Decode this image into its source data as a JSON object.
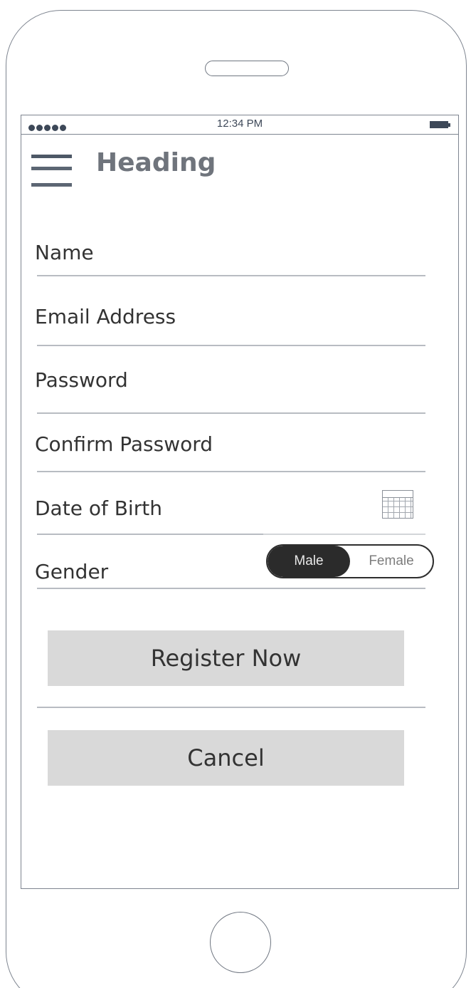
{
  "status_bar": {
    "time": "12:34 PM",
    "signal_dots": 5,
    "battery_icon": "battery-icon"
  },
  "header": {
    "menu_icon": "hamburger-menu-icon",
    "title": "Heading"
  },
  "form": {
    "name_label": "Name",
    "email_label": "Email Address",
    "password_label": "Password",
    "confirm_password_label": "Confirm Password",
    "dob_label": "Date of Birth",
    "dob_icon": "calendar-icon",
    "gender_label": "Gender",
    "gender_options": [
      "Male",
      "Female"
    ],
    "gender_selected": "Male"
  },
  "actions": {
    "register_label": "Register Now",
    "cancel_label": "Cancel"
  },
  "colors": {
    "button_bg": "#d9d9d9",
    "toggle_active": "#2b2b2b",
    "heading": "#6f747c",
    "frame": "#7e8590"
  }
}
